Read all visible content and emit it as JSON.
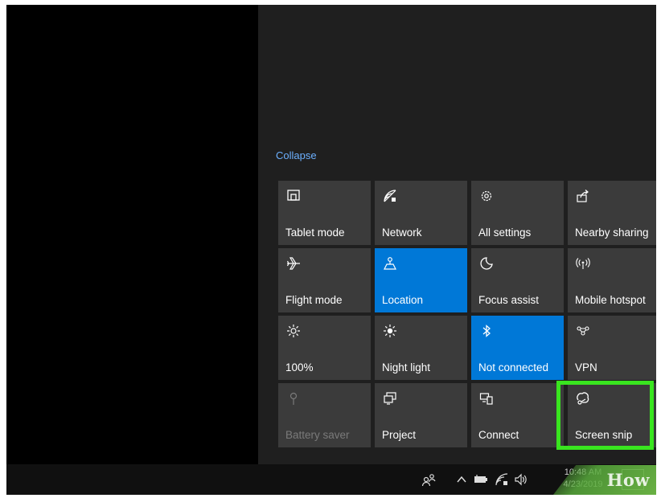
{
  "action_center": {
    "collapse_label": "Collapse",
    "tiles": [
      {
        "label": "Tablet mode",
        "icon": "tablet-mode-icon",
        "state": "normal"
      },
      {
        "label": "Network",
        "icon": "network-icon",
        "state": "normal"
      },
      {
        "label": "All settings",
        "icon": "gear-icon",
        "state": "normal"
      },
      {
        "label": "Nearby sharing",
        "icon": "share-icon",
        "state": "normal"
      },
      {
        "label": "Flight mode",
        "icon": "airplane-icon",
        "state": "normal"
      },
      {
        "label": "Location",
        "icon": "location-icon",
        "state": "active"
      },
      {
        "label": "Focus assist",
        "icon": "moon-icon",
        "state": "normal"
      },
      {
        "label": "Mobile hotspot",
        "icon": "hotspot-icon",
        "state": "normal"
      },
      {
        "label": "100%",
        "icon": "brightness-icon",
        "state": "normal"
      },
      {
        "label": "Night light",
        "icon": "night-light-icon",
        "state": "normal"
      },
      {
        "label": "Not connected",
        "icon": "bluetooth-icon",
        "state": "active"
      },
      {
        "label": "VPN",
        "icon": "vpn-icon",
        "state": "normal"
      },
      {
        "label": "Battery saver",
        "icon": "battery-saver-icon",
        "state": "disabled"
      },
      {
        "label": "Project",
        "icon": "project-icon",
        "state": "normal"
      },
      {
        "label": "Connect",
        "icon": "connect-icon",
        "state": "normal"
      },
      {
        "label": "Screen snip",
        "icon": "screen-snip-icon",
        "state": "normal"
      }
    ]
  },
  "taskbar": {
    "clock_time": "10:48 AM",
    "clock_date": "4/23/2019"
  },
  "watermark": {
    "text": "How"
  },
  "colors": {
    "accent": "#0078d7",
    "highlight": "#39e51f",
    "tile": "#3b3b3b",
    "link": "#6cb0ff"
  }
}
